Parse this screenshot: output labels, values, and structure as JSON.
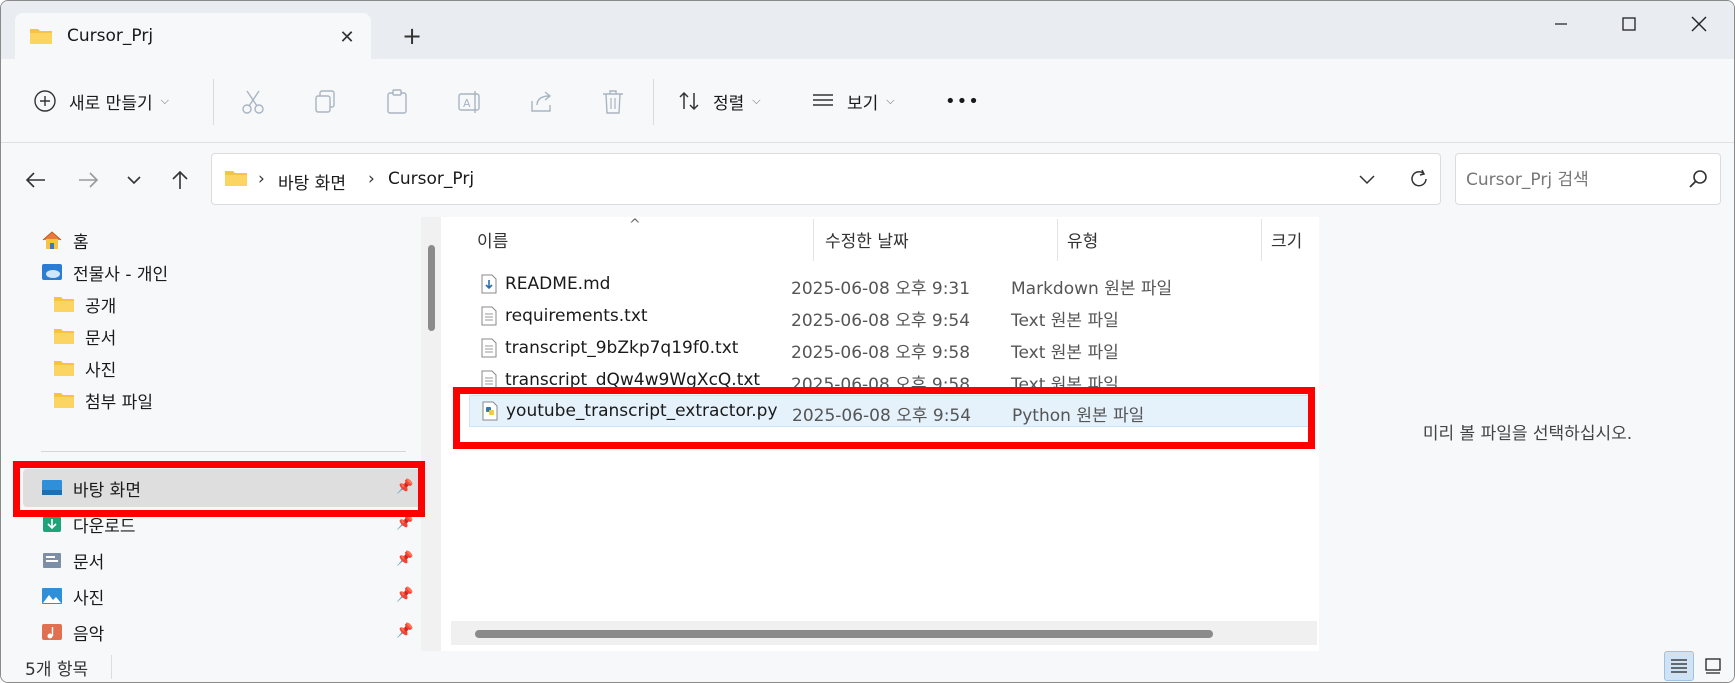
{
  "tab": {
    "title": "Cursor_Prj",
    "close": "✕",
    "new_tab": "+"
  },
  "toolbar": {
    "new_label": "새로 만들기",
    "sort_label": "정렬",
    "view_label": "보기",
    "more": "•••"
  },
  "address": {
    "crumbs": [
      "바탕 화면",
      "Cursor_Prj"
    ],
    "separator": "›"
  },
  "search": {
    "placeholder": "Cursor_Prj 검색"
  },
  "nav": {
    "home": "홈",
    "onedrive": "전물사 - 개인",
    "sub_items": [
      "공개",
      "문서",
      "사진",
      "첨부 파일"
    ],
    "quick": [
      "바탕 화면",
      "다운로드",
      "문서",
      "사진",
      "음악"
    ]
  },
  "columns": {
    "name": "이름",
    "date": "수정한 날짜",
    "type": "유형",
    "size": "크기"
  },
  "files": [
    {
      "name": "README.md",
      "date": "2025-06-08 오후 9:31",
      "type": "Markdown 원본 파일",
      "icon": "markdown-file-icon"
    },
    {
      "name": "requirements.txt",
      "date": "2025-06-08 오후 9:54",
      "type": "Text 원본 파일",
      "icon": "text-file-icon"
    },
    {
      "name": "transcript_9bZkp7q19f0.txt",
      "date": "2025-06-08 오후 9:58",
      "type": "Text 원본 파일",
      "icon": "text-file-icon"
    },
    {
      "name": "transcript_dQw4w9WgXcQ.txt",
      "date": "2025-06-08 오후 9:58",
      "type": "Text 원본 파일",
      "icon": "text-file-icon"
    },
    {
      "name": "youtube_transcript_extractor.py",
      "date": "2025-06-08 오후 9:54",
      "type": "Python 원본 파일",
      "icon": "python-file-icon"
    }
  ],
  "preview": {
    "message": "미리 볼 파일을 선택하십시오."
  },
  "status": {
    "count": "5개 항목"
  },
  "colors": {
    "highlight": "#ff0000",
    "selected_row": "#e5f1fb",
    "folder": "#f6c343"
  }
}
